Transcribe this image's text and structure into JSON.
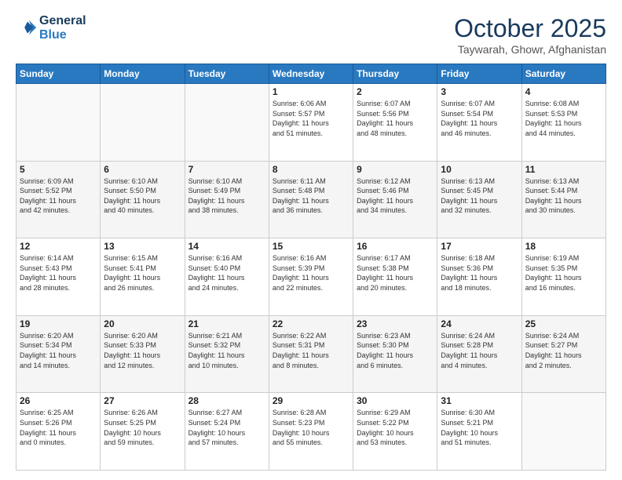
{
  "header": {
    "logo_line1": "General",
    "logo_line2": "Blue",
    "month": "October 2025",
    "location": "Taywarah, Ghowr, Afghanistan"
  },
  "weekdays": [
    "Sunday",
    "Monday",
    "Tuesday",
    "Wednesday",
    "Thursday",
    "Friday",
    "Saturday"
  ],
  "weeks": [
    [
      {
        "day": "",
        "info": ""
      },
      {
        "day": "",
        "info": ""
      },
      {
        "day": "",
        "info": ""
      },
      {
        "day": "1",
        "info": "Sunrise: 6:06 AM\nSunset: 5:57 PM\nDaylight: 11 hours\nand 51 minutes."
      },
      {
        "day": "2",
        "info": "Sunrise: 6:07 AM\nSunset: 5:56 PM\nDaylight: 11 hours\nand 48 minutes."
      },
      {
        "day": "3",
        "info": "Sunrise: 6:07 AM\nSunset: 5:54 PM\nDaylight: 11 hours\nand 46 minutes."
      },
      {
        "day": "4",
        "info": "Sunrise: 6:08 AM\nSunset: 5:53 PM\nDaylight: 11 hours\nand 44 minutes."
      }
    ],
    [
      {
        "day": "5",
        "info": "Sunrise: 6:09 AM\nSunset: 5:52 PM\nDaylight: 11 hours\nand 42 minutes."
      },
      {
        "day": "6",
        "info": "Sunrise: 6:10 AM\nSunset: 5:50 PM\nDaylight: 11 hours\nand 40 minutes."
      },
      {
        "day": "7",
        "info": "Sunrise: 6:10 AM\nSunset: 5:49 PM\nDaylight: 11 hours\nand 38 minutes."
      },
      {
        "day": "8",
        "info": "Sunrise: 6:11 AM\nSunset: 5:48 PM\nDaylight: 11 hours\nand 36 minutes."
      },
      {
        "day": "9",
        "info": "Sunrise: 6:12 AM\nSunset: 5:46 PM\nDaylight: 11 hours\nand 34 minutes."
      },
      {
        "day": "10",
        "info": "Sunrise: 6:13 AM\nSunset: 5:45 PM\nDaylight: 11 hours\nand 32 minutes."
      },
      {
        "day": "11",
        "info": "Sunrise: 6:13 AM\nSunset: 5:44 PM\nDaylight: 11 hours\nand 30 minutes."
      }
    ],
    [
      {
        "day": "12",
        "info": "Sunrise: 6:14 AM\nSunset: 5:43 PM\nDaylight: 11 hours\nand 28 minutes."
      },
      {
        "day": "13",
        "info": "Sunrise: 6:15 AM\nSunset: 5:41 PM\nDaylight: 11 hours\nand 26 minutes."
      },
      {
        "day": "14",
        "info": "Sunrise: 6:16 AM\nSunset: 5:40 PM\nDaylight: 11 hours\nand 24 minutes."
      },
      {
        "day": "15",
        "info": "Sunrise: 6:16 AM\nSunset: 5:39 PM\nDaylight: 11 hours\nand 22 minutes."
      },
      {
        "day": "16",
        "info": "Sunrise: 6:17 AM\nSunset: 5:38 PM\nDaylight: 11 hours\nand 20 minutes."
      },
      {
        "day": "17",
        "info": "Sunrise: 6:18 AM\nSunset: 5:36 PM\nDaylight: 11 hours\nand 18 minutes."
      },
      {
        "day": "18",
        "info": "Sunrise: 6:19 AM\nSunset: 5:35 PM\nDaylight: 11 hours\nand 16 minutes."
      }
    ],
    [
      {
        "day": "19",
        "info": "Sunrise: 6:20 AM\nSunset: 5:34 PM\nDaylight: 11 hours\nand 14 minutes."
      },
      {
        "day": "20",
        "info": "Sunrise: 6:20 AM\nSunset: 5:33 PM\nDaylight: 11 hours\nand 12 minutes."
      },
      {
        "day": "21",
        "info": "Sunrise: 6:21 AM\nSunset: 5:32 PM\nDaylight: 11 hours\nand 10 minutes."
      },
      {
        "day": "22",
        "info": "Sunrise: 6:22 AM\nSunset: 5:31 PM\nDaylight: 11 hours\nand 8 minutes."
      },
      {
        "day": "23",
        "info": "Sunrise: 6:23 AM\nSunset: 5:30 PM\nDaylight: 11 hours\nand 6 minutes."
      },
      {
        "day": "24",
        "info": "Sunrise: 6:24 AM\nSunset: 5:28 PM\nDaylight: 11 hours\nand 4 minutes."
      },
      {
        "day": "25",
        "info": "Sunrise: 6:24 AM\nSunset: 5:27 PM\nDaylight: 11 hours\nand 2 minutes."
      }
    ],
    [
      {
        "day": "26",
        "info": "Sunrise: 6:25 AM\nSunset: 5:26 PM\nDaylight: 11 hours\nand 0 minutes."
      },
      {
        "day": "27",
        "info": "Sunrise: 6:26 AM\nSunset: 5:25 PM\nDaylight: 10 hours\nand 59 minutes."
      },
      {
        "day": "28",
        "info": "Sunrise: 6:27 AM\nSunset: 5:24 PM\nDaylight: 10 hours\nand 57 minutes."
      },
      {
        "day": "29",
        "info": "Sunrise: 6:28 AM\nSunset: 5:23 PM\nDaylight: 10 hours\nand 55 minutes."
      },
      {
        "day": "30",
        "info": "Sunrise: 6:29 AM\nSunset: 5:22 PM\nDaylight: 10 hours\nand 53 minutes."
      },
      {
        "day": "31",
        "info": "Sunrise: 6:30 AM\nSunset: 5:21 PM\nDaylight: 10 hours\nand 51 minutes."
      },
      {
        "day": "",
        "info": ""
      }
    ]
  ]
}
